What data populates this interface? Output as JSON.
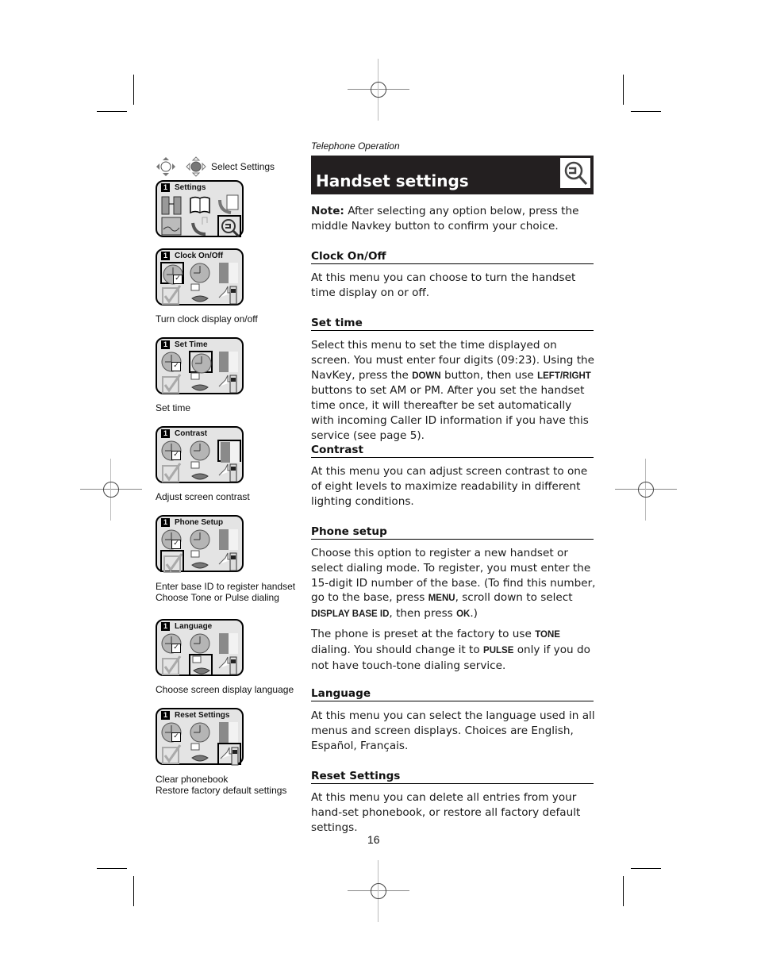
{
  "header": {
    "section": "Telephone Operation",
    "title": "Handset settings"
  },
  "nav_hint": {
    "label": "Select Settings"
  },
  "screens": [
    {
      "number": "1",
      "title": "Settings",
      "caption": []
    },
    {
      "number": "1",
      "title": "Clock On/Off",
      "caption": [
        "Turn clock display on/off"
      ]
    },
    {
      "number": "1",
      "title": "Set Time",
      "caption": [
        "Set time"
      ]
    },
    {
      "number": "1",
      "title": "Contrast",
      "caption": [
        "Adjust screen contrast"
      ]
    },
    {
      "number": "1",
      "title": "Phone Setup",
      "caption": [
        "Enter base ID to register handset",
        "Choose Tone or Pulse dialing"
      ]
    },
    {
      "number": "1",
      "title": "Language",
      "caption": [
        "Choose screen display language"
      ]
    },
    {
      "number": "1",
      "title": "Reset Settings",
      "caption": [
        "Clear phonebook",
        "Restore factory default settings"
      ]
    }
  ],
  "note": {
    "label": "Note:",
    "text": " After selecting any option below, press the middle Navkey button to confirm your choice."
  },
  "sections": [
    {
      "heading": "Clock On/Off",
      "body": "At this menu you can choose to turn the handset time display on or off."
    },
    {
      "heading": "Set time",
      "body_parts": [
        "Select this menu to set the time displayed on screen. You must enter four digits (09:23). Using the NavKey, press the ",
        "DOWN",
        " button, then use ",
        "LEFT/RIGHT",
        " buttons to set AM or PM. After you set the handset time once, it will thereafter be set automatically with incoming Caller ID information if you have this service (see page 5)."
      ]
    },
    {
      "heading": "Contrast",
      "body": "At this menu you can adjust screen contrast to one of eight levels to maximize readability in different lighting conditions."
    },
    {
      "heading": "Phone setup",
      "body_parts": [
        "Choose this option to register a new handset or select dialing mode. To register, you must enter the 15-digit ID number of the base. (To find this number, go to the base, press ",
        "MENU",
        ", scroll down to select ",
        "DISPLAY BASE ID",
        ", then press ",
        "OK",
        ".)"
      ],
      "body2_parts": [
        "The phone is preset at the factory to use ",
        "TONE",
        " dialing. You should change it to ",
        "PULSE",
        " only if you do not have touch-tone dialing service."
      ]
    },
    {
      "heading": "Language",
      "body": "At this menu you can select the language used in all menus and screen displays. Choices are English, Español, Français."
    },
    {
      "heading": "Reset Settings",
      "body": "At this menu you can delete all entries from your hand-set phonebook, or restore all factory default settings."
    }
  ],
  "page_number": "16"
}
